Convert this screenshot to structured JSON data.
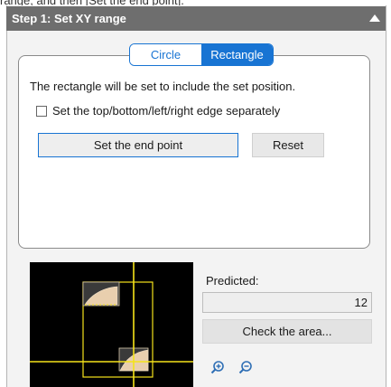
{
  "top_fragment": "range, and then [Set the end point].",
  "panel": {
    "title": "Step 1: Set XY range"
  },
  "shape_toggle": {
    "circle_label": "Circle",
    "rectangle_label": "Rectangle",
    "selected": "Rectangle"
  },
  "description": "The rectangle will be set to include the set position.",
  "separate_edges": {
    "label": "Set the top/bottom/left/right edge separately",
    "checked": false
  },
  "buttons": {
    "set_end_point": "Set the end point",
    "reset": "Reset",
    "check_area": "Check the area..."
  },
  "predicted": {
    "label": "Predicted:",
    "value": "12"
  },
  "icons": {
    "zoom_in": "zoom-in-icon",
    "zoom_out": "zoom-out-icon",
    "collapse": "collapse-triangle-icon"
  },
  "colors": {
    "header_bg": "#6e6e6e",
    "accent_blue": "#1874d3",
    "crosshair_yellow": "#f5e31a",
    "preview_bg": "#000000"
  }
}
